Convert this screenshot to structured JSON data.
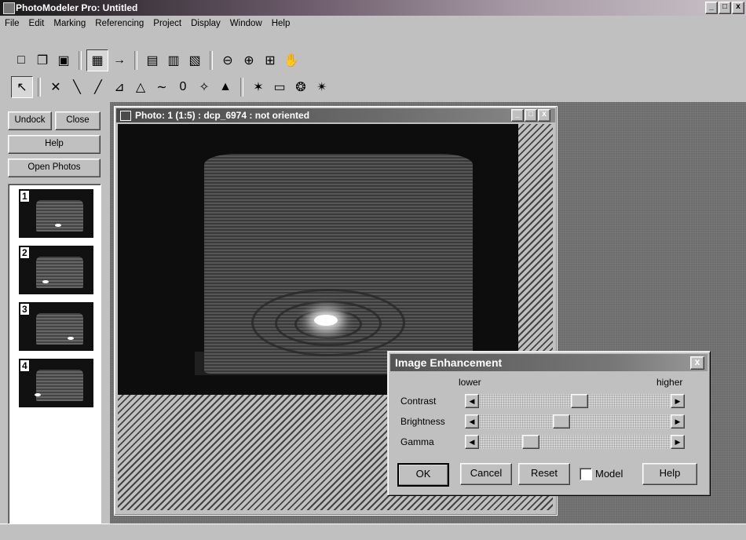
{
  "app": {
    "title": "PhotoModeler Pro: Untitled"
  },
  "window_controls": {
    "minimize": "_",
    "maximize": "□",
    "close": "x"
  },
  "menu": [
    {
      "label": "File"
    },
    {
      "label": "Edit"
    },
    {
      "label": "Marking"
    },
    {
      "label": "Referencing"
    },
    {
      "label": "Project"
    },
    {
      "label": "Display"
    },
    {
      "label": "Window"
    },
    {
      "label": "Help"
    }
  ],
  "toolbar1": [
    {
      "icon": "new-icon",
      "glyph": "□"
    },
    {
      "icon": "open-folder-icon",
      "glyph": "❐"
    },
    {
      "icon": "save-icon",
      "glyph": "▣"
    },
    {
      "icon": "thumbnails-icon",
      "glyph": "▦"
    },
    {
      "icon": "points-table-icon",
      "glyph": "→"
    },
    {
      "icon": "photo-view-icon",
      "glyph": "▤"
    },
    {
      "icon": "table-view-icon",
      "glyph": "▥"
    },
    {
      "icon": "3d-view-icon",
      "glyph": "▧"
    },
    {
      "icon": "zoom-out-icon",
      "glyph": "⊖"
    },
    {
      "icon": "zoom-in-icon",
      "glyph": "⊕"
    },
    {
      "icon": "zoom-fit-icon",
      "glyph": "⊞"
    },
    {
      "icon": "pan-hand-icon",
      "glyph": "✋"
    }
  ],
  "toolbar2": [
    {
      "icon": "pointer-icon",
      "glyph": "↖"
    },
    {
      "icon": "mark-point-icon",
      "glyph": "✕"
    },
    {
      "icon": "mark-line-icon",
      "glyph": "╲"
    },
    {
      "icon": "mark-edge-icon",
      "glyph": "╱"
    },
    {
      "icon": "mark-corner-icon",
      "glyph": "⊿"
    },
    {
      "icon": "mark-surface-icon",
      "glyph": "△"
    },
    {
      "icon": "mark-curve-icon",
      "glyph": "∼"
    },
    {
      "icon": "mark-cylinder-icon",
      "glyph": "0"
    },
    {
      "icon": "target-icon",
      "glyph": "✧"
    },
    {
      "icon": "triangle-icon",
      "glyph": "▲"
    },
    {
      "icon": "reference-icon",
      "glyph": "✶"
    },
    {
      "icon": "tape-measure-icon",
      "glyph": "▭"
    },
    {
      "icon": "process-icon",
      "glyph": "❂"
    },
    {
      "icon": "tools-icon",
      "glyph": "✴"
    }
  ],
  "left_panel": {
    "undock": "Undock",
    "close": "Close",
    "help": "Help",
    "open_photos": "Open Photos",
    "thumbs": [
      {
        "num": "1"
      },
      {
        "num": "2"
      },
      {
        "num": "3"
      },
      {
        "num": "4"
      }
    ]
  },
  "photo_window": {
    "title": "Photo: 1 (1:5) : dcp_6974 : not oriented"
  },
  "dialog": {
    "title": "Image Enhancement",
    "close": "x",
    "lower": "lower",
    "higher": "higher",
    "sliders": [
      {
        "label": "Contrast",
        "value": 0.52
      },
      {
        "label": "Brightness",
        "value": 0.42
      },
      {
        "label": "Gamma",
        "value": 0.25
      }
    ],
    "ok": "OK",
    "cancel": "Cancel",
    "reset": "Reset",
    "model": "Model",
    "model_checked": false,
    "help": "Help"
  }
}
